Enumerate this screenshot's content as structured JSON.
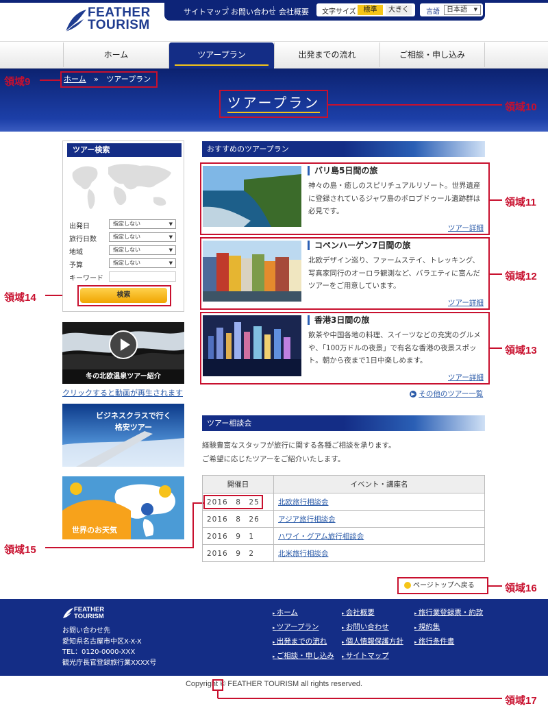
{
  "header": {
    "logo_line1": "FEATHER",
    "logo_line2": "TOURISM",
    "links": [
      "サイトマップ",
      "お問い合わせ",
      "会社概要"
    ],
    "font_size_label": "文字サイズ",
    "font_size_standard": "標準",
    "font_size_large": "大きく",
    "language_label": "言語",
    "language_value": "日本語"
  },
  "nav": {
    "items": [
      "ホーム",
      "ツアープラン",
      "出発までの流れ",
      "ご相談・申し込み"
    ],
    "active": "ツアープラン"
  },
  "hero": {
    "breadcrumb_home": "ホーム",
    "breadcrumb_sep": "»",
    "breadcrumb_current": "ツアープラン",
    "title": "ツアープラン"
  },
  "annotations": [
    "領域9",
    "領域10",
    "領域11",
    "領域12",
    "領域13",
    "領域14",
    "領域15",
    "領域16",
    "領域17"
  ],
  "sidebar": {
    "search_title": "ツアー検索",
    "fields": [
      {
        "label": "出発日",
        "value": "指定しない"
      },
      {
        "label": "旅行日数",
        "value": "指定しない"
      },
      {
        "label": "地域",
        "value": "指定しない"
      },
      {
        "label": "予算",
        "value": "指定しない"
      }
    ],
    "keyword_label": "キーワード",
    "search_button": "検索",
    "video_label": "冬の北欧温泉ツアー紹介",
    "video_link": "クリックすると動画が再生されます",
    "banner_business_line1": "ビジネスクラスで行く",
    "banner_business_line2": "格安ツアー",
    "banner_weather": "世界のお天気"
  },
  "recommended": {
    "heading": "おすすめのツアープラン",
    "tours": [
      {
        "title": "バリ島5日間の旅",
        "desc": "神々の島・癒しのスピリチュアルリゾート。世界遺産に登録されているジャワ島のボロブドゥール遺跡群は必見です。",
        "link": "ツアー詳細"
      },
      {
        "title": "コペンハーゲン7日間の旅",
        "desc": "北欧デザイン巡り、ファームステイ、トレッキング、写真家同行のオーロラ観測など、バラエティに富んだツアーをご用意しています。",
        "link": "ツアー詳細"
      },
      {
        "title": "香港3日間の旅",
        "desc": "飲茶や中国各地の料理、スイーツなどの充実のグルメや、「100万ドルの夜景」で有名な香港の夜景スポット。朝から夜まで1日中楽しめます。",
        "link": "ツアー詳細"
      }
    ],
    "more_link": "その他のツアー一覧"
  },
  "consultation": {
    "heading": "ツアー相談会",
    "text_line1": "経験豊富なスタッフが旅行に関する各種ご相談を承ります。",
    "text_line2": "ご希望に応じたツアーをご紹介いたします。",
    "col_date": "開催日",
    "col_event": "イベント・講座名",
    "rows": [
      {
        "date": "2016　8　25",
        "event": "北欧旅行相談会"
      },
      {
        "date": "2016　8　26",
        "event": "アジア旅行相談会"
      },
      {
        "date": "2016　9　1",
        "event": "ハワイ・グアム旅行相談会"
      },
      {
        "date": "2016　9　2",
        "event": "北米旅行相談会"
      }
    ]
  },
  "page_top": "ページトップへ戻る",
  "footer": {
    "logo_line1": "FEATHER",
    "logo_line2": "TOURISM",
    "contact_label": "お問い合わせ先",
    "address": "愛知県名古屋市中区X-X-X",
    "tel": "TEL：0120-0000-XXX",
    "registration": "観光庁長官登録旅行業XXXX号",
    "col1": [
      "ホーム",
      "ツアープラン",
      "出発までの流れ",
      "ご相談・申し込み"
    ],
    "col2": [
      "会社概要",
      "お問い合わせ",
      "個人情報保護方針",
      "サイトマップ"
    ],
    "col3": [
      "旅行業登録票・約款",
      "規約集",
      "旅行条件書"
    ],
    "copyright": "Copyright © FEATHER TOURISM all rights reserved."
  },
  "colors": {
    "primary": "#142d86",
    "accent": "#f5c518",
    "annotation": "#c8102e"
  }
}
